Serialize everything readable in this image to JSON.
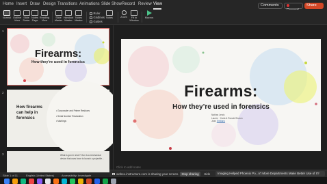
{
  "menu": {
    "tabs": [
      "Home",
      "Insert",
      "Draw",
      "Design",
      "Transitions",
      "Animations",
      "Slide Show",
      "Record",
      "Review",
      "View"
    ],
    "active_tab": "View",
    "comments_label": "Comments",
    "record_label": "Record",
    "share_label": "Share"
  },
  "ribbon": {
    "normal": "Normal",
    "outline_view": "Outline View",
    "slide_sorter": "Slide Sorter",
    "notes_page": "Notes Page",
    "reading_view": "Reading View",
    "slide_master": "Slide Master",
    "handout_master": "Handout Master",
    "notes_master": "Notes Master",
    "ruler": "Ruler",
    "gridlines": "Gridlines",
    "guides": "Guides",
    "notes": "Notes",
    "zoom": "Zoom",
    "fit_to_window": "Fit to Window",
    "macros": "Macros"
  },
  "thumbnails": {
    "slide1": {
      "number": "1",
      "title": "Firearms:",
      "subtitle": "How they’re used in forensics"
    },
    "slide2": {
      "number": "2",
      "title": "How firearms can help in forensics",
      "bullets": [
        "Gunpowder and Primer Residues",
        "Serial Number Restoration",
        "Markings"
      ]
    },
    "slide3": {
      "number": "3",
      "text": "What is gun in short? Gun is a mechanical device that uses force to launch a projectile..."
    }
  },
  "main_slide": {
    "title": "Firearms:",
    "subtitle": "How they’re used in forensics",
    "names": [
      "Nathan Lewis",
      "Lauren · Carla & Ronald Sharon",
      "Jean"
    ],
    "link": "Emiliano"
  },
  "notes_peek": "Click to add notes",
  "share_bar": {
    "message": "webex.instructure.com is sharing your screen.",
    "stop_label": "Stop sharing",
    "hide_label": "Hide",
    "tooltip": "Imaging Helped Phoenix Po...n't More Departments Make Better Use of It?"
  },
  "status": {
    "slide_of": "Slide 1 of 11",
    "language": "English (United States)",
    "accessibility": "Accessibility: Investigate"
  },
  "colors": {
    "share_button": "#d24726",
    "thumb_selected_border": "#e0706a",
    "macros_icon": "#4cc38a"
  }
}
